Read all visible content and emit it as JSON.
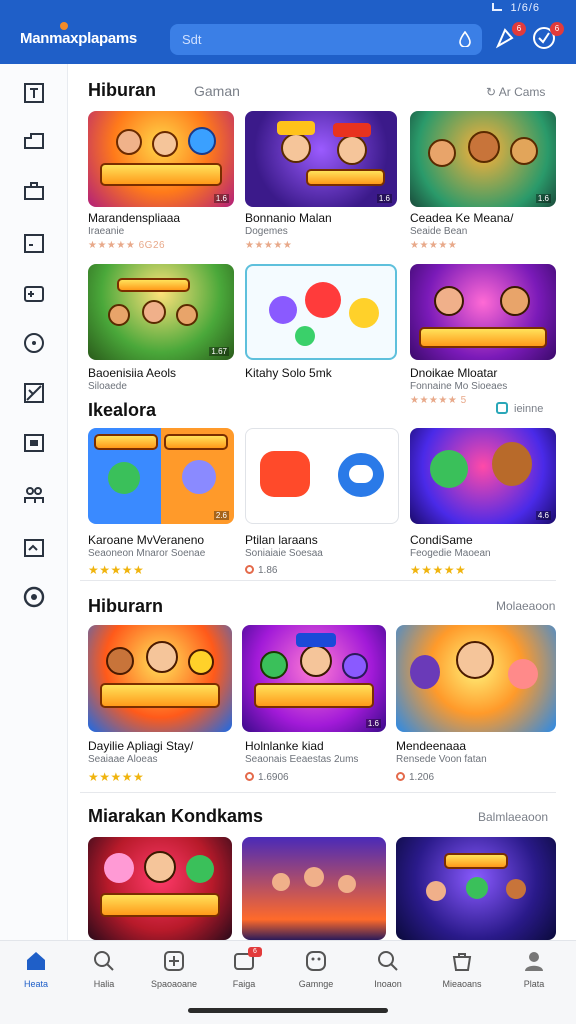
{
  "header": {
    "logo": "Manmaxplapams",
    "search_placeholder": "Sdt",
    "notification_badge": "6",
    "profile_badge": "6",
    "status_time": "1/6/6",
    "colors": {
      "bar": "#1f5fc8",
      "search": "#3b7fe6"
    }
  },
  "sidebar": {
    "icons": [
      "text-icon",
      "folder-icon",
      "briefcase-icon",
      "calendar-icon",
      "gamepad-icon",
      "compass-icon",
      "puzzle-icon",
      "store-icon",
      "group-icon",
      "gift-icon",
      "settings-icon"
    ]
  },
  "sections": [
    {
      "title": "Hiburan",
      "subtitle": "Gaman",
      "link": "Ar Cams",
      "cards": [
        {
          "title": "Marandenspliaaa",
          "subtitle": "Iraeanie",
          "rating": "★★★★★ 6G26",
          "size": "1.6"
        },
        {
          "title": "Bonnanio Malan",
          "subtitle": "Dogemes",
          "rating": "★★★★★",
          "size": "1.6"
        },
        {
          "title": "Ceadea Ke Meana/",
          "subtitle": "Seaide Bean",
          "rating": "★★★★★",
          "size": "1.6"
        },
        {
          "title": "Baoenisiia Aeols",
          "subtitle": "Siloaede",
          "rating": "",
          "size": "1.67"
        },
        {
          "title": "Kitahy Solo 5mk",
          "subtitle": "",
          "rating": "",
          "size": ""
        },
        {
          "title": "Dnoikae Mloatar",
          "subtitle": "Fonnaine Mo Sioeaes",
          "rating": "★★★★★ 5",
          "size": ""
        }
      ]
    },
    {
      "title": "Ikealora",
      "link": "ieinne",
      "cards": [
        {
          "title": "Karoane MvVeraneno",
          "subtitle": "Seaoneon Mnaror Soenae",
          "rating": "★★★★★",
          "size": "2.6"
        },
        {
          "title": "Ptilan laraans",
          "subtitle": "Soniaiaie Soesaa",
          "price": "1.86",
          "size": ""
        },
        {
          "title": "CondiSame",
          "subtitle": "Feogedie Maoean",
          "rating": "★★★★★",
          "size": "4.6"
        }
      ]
    },
    {
      "title": "Hiburarn",
      "link": "Molaeaoon",
      "cards": [
        {
          "title": "Dayilie Apliagi Stay/",
          "subtitle": "Seaiaae Aloeas",
          "rating": "★★★★★",
          "size": ""
        },
        {
          "title": "Holnlanke kiad",
          "subtitle": "Seaonais Eeaestas 2ums",
          "price": "1.6906",
          "size": "1.6"
        },
        {
          "title": "Mendeenaaa",
          "subtitle": "Rensede Voon fatan",
          "price": "1.206",
          "size": ""
        }
      ]
    },
    {
      "title": "Miarakan Kondkams",
      "link": "Balmlaeaoon",
      "cards": [
        {
          "title": "",
          "subtitle": "",
          "size": ""
        },
        {
          "title": "",
          "subtitle": "",
          "size": ""
        },
        {
          "title": "",
          "subtitle": "",
          "size": ""
        }
      ]
    }
  ],
  "bottom_nav": [
    {
      "label": "Heata",
      "icon": "home-icon"
    },
    {
      "label": "Halia",
      "icon": "search-icon"
    },
    {
      "label": "Spaoaoane",
      "icon": "grid-icon"
    },
    {
      "label": "Faiga",
      "icon": "inbox-icon",
      "badge": "6"
    },
    {
      "label": "Gamnge",
      "icon": "smile-icon"
    },
    {
      "label": "Inoaon",
      "icon": "search-icon"
    },
    {
      "label": "Mieaoans",
      "icon": "bag-icon"
    },
    {
      "label": "Plata",
      "icon": "profile-icon"
    }
  ]
}
